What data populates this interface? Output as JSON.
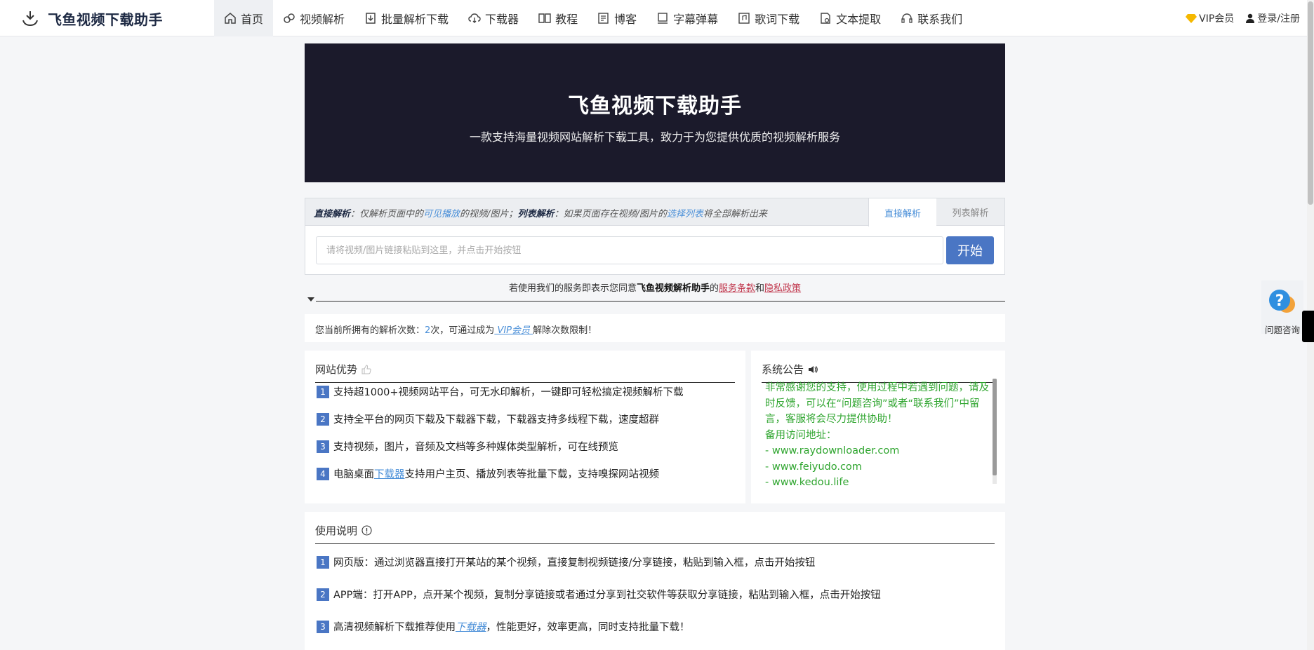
{
  "brand": {
    "title": "飞鱼视频下载助手"
  },
  "nav": {
    "items": [
      {
        "label": "首页",
        "icon": "home-icon",
        "active": true
      },
      {
        "label": "视频解析",
        "icon": "link-icon"
      },
      {
        "label": "批量解析下载",
        "icon": "batch-download-icon"
      },
      {
        "label": "下载器",
        "icon": "cloud-download-icon"
      },
      {
        "label": "教程",
        "icon": "book-icon"
      },
      {
        "label": "博客",
        "icon": "edit-icon"
      },
      {
        "label": "字幕弹幕",
        "icon": "subtitle-icon"
      },
      {
        "label": "歌词下载",
        "icon": "lyrics-icon"
      },
      {
        "label": "文本提取",
        "icon": "text-extract-icon"
      },
      {
        "label": "联系我们",
        "icon": "headset-icon"
      }
    ],
    "vip_label": "VIP会员",
    "login_label": "登录/注册"
  },
  "hero": {
    "title": "飞鱼视频下载助手",
    "subtitle": "一款支持海量视频网站解析下载工具，致力于为您提供优质的视频解析服务"
  },
  "parse": {
    "desc_direct_label": "直接解析",
    "desc_part1": "：仅解析页面中的",
    "desc_hl1": "可见播放",
    "desc_part2": "的视频/图片；",
    "desc_list_label": "列表解析",
    "desc_part3": "：如果页面存在视频/图片的",
    "desc_hl2": "选择列表",
    "desc_part4": "将全部解析出来",
    "tab_direct": "直接解析",
    "tab_list": "列表解析",
    "input_placeholder": "请将视频/图片链接粘贴到这里，并点击开始按钮",
    "start_label": "开始"
  },
  "agree": {
    "prefix": "若使用我们的服务即表示您同意",
    "brand": "飞鱼视频解析助手",
    "of": "的",
    "terms": "服务条款",
    "and": "和",
    "privacy": "隐私政策"
  },
  "quota": {
    "prefix": "您当前所拥有的解析次数：",
    "count": "2",
    "mid": "次，可通过成为",
    "vip": " VIP会员 ",
    "suffix": "解除次数限制！"
  },
  "advantages": {
    "title": "网站优势",
    "items": [
      {
        "num": "1",
        "text": "支持超1000+视频网站平台，可无水印解析，一键即可轻松搞定视频解析下载"
      },
      {
        "num": "2",
        "text": "支持全平台的网页下载及下载器下载，下载器支持多线程下载，速度超群"
      },
      {
        "num": "3",
        "text": "支持视频，图片，音频及文档等多种媒体类型解析，可在线预览"
      },
      {
        "num": "4",
        "pre": "电脑桌面",
        "link": "下载器",
        "post": "支持用户主页、播放列表等批量下载，支持嗅探网站视频"
      }
    ]
  },
  "notice": {
    "title": "系统公告",
    "lines": [
      "非常感谢您的支持，使用过程中若遇到问题，请及时反馈，可以在“问题咨询”或者“联系我们”中留言，客服将会尽力提供协助！",
      "备用访问地址：",
      "- www.raydownloader.com",
      "- www.feiyudo.com",
      "- www.kedou.life"
    ]
  },
  "usage": {
    "title": "使用说明",
    "items": [
      {
        "num": "1",
        "text": "网页版：通过浏览器直接打开某站的某个视频，直接复制视频链接/分享链接，粘贴到输入框，点击开始按钮"
      },
      {
        "num": "2",
        "text": "APP端：打开APP，点开某个视频，复制分享链接或者通过分享到社交软件等获取分享链接，粘贴到输入框，点击开始按钮"
      },
      {
        "num": "3",
        "pre": "高清视频解析下载推荐使用",
        "link": "下载器",
        "post": "，性能更好，效率更高，同时支持批量下载！"
      }
    ]
  },
  "float_help": {
    "label": "问题咨询"
  }
}
